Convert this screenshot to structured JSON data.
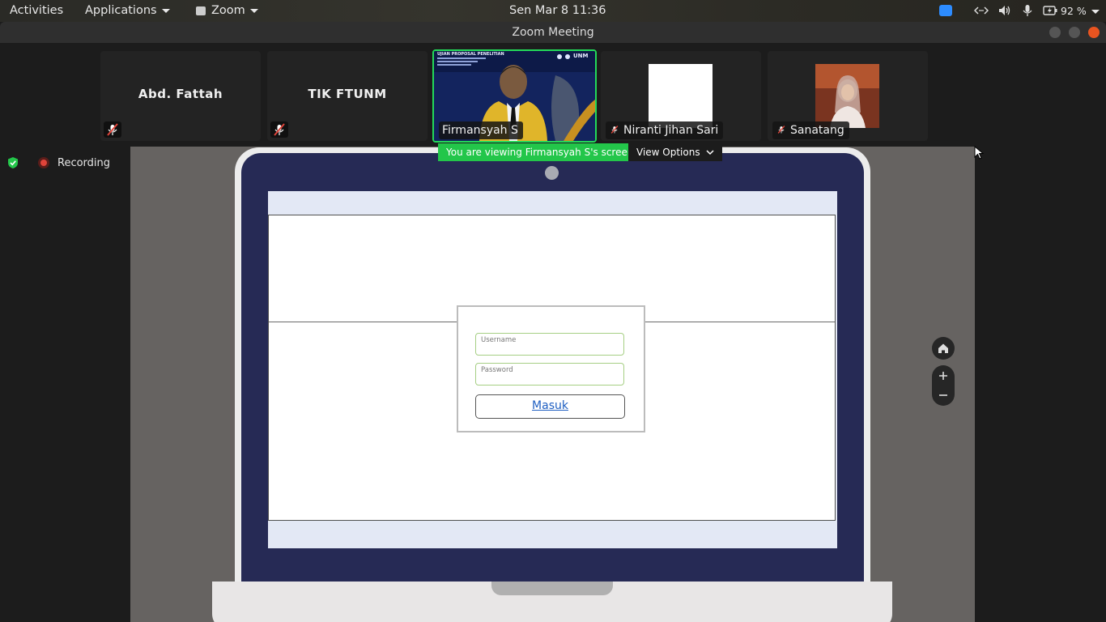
{
  "topbar": {
    "activities": "Activities",
    "applications": "Applications",
    "app": "Zoom",
    "clock": "Sen Mar 8  11:36",
    "battery": "92 %"
  },
  "window": {
    "title": "Zoom Meeting"
  },
  "participants": {
    "abd": "Abd. Fattah",
    "tik": "TIK FTUNM",
    "firmansyah": "Firmansyah S",
    "niranti": "Niranti Jihan Sari",
    "sanatang": "Sanatang"
  },
  "speaker_slide": {
    "title": "UJIAN PROPOSAL PENELITIAN",
    "logo": "UNM"
  },
  "recording": {
    "label": "Recording"
  },
  "share": {
    "banner": "You are viewing Firmansyah S's screen",
    "view_options": "View Options"
  },
  "login": {
    "username_placeholder": "Username",
    "password_placeholder": "Password",
    "submit": "Masuk"
  },
  "colors": {
    "accent_green": "#23c64a",
    "zoom_blue": "#2d8cff",
    "record_red": "#e0443a"
  }
}
